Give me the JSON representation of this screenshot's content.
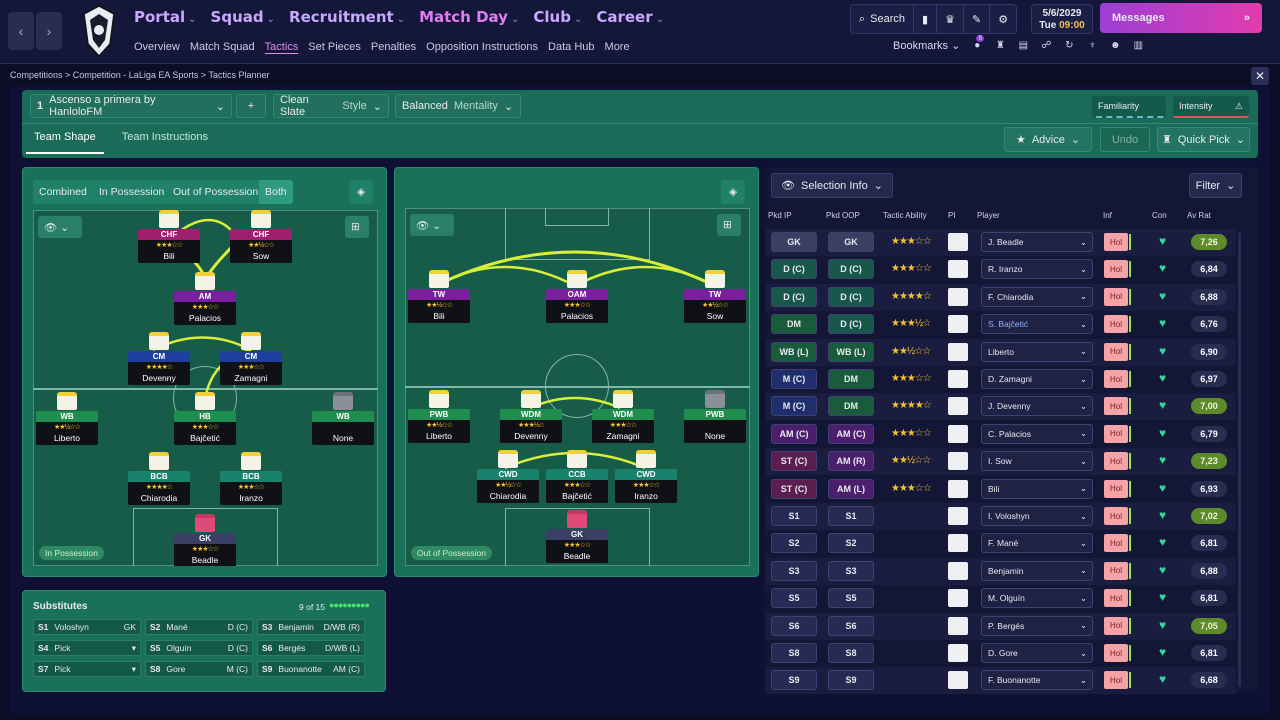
{
  "nav": {
    "main": [
      "Portal",
      "Squad",
      "Recruitment",
      "Match Day",
      "Club",
      "Career"
    ],
    "sub": [
      "Overview",
      "Match Squad",
      "Tactics",
      "Set Pieces",
      "Penalties",
      "Opposition Instructions",
      "Data Hub",
      "More"
    ],
    "search": "Search",
    "date": "5/6/2029",
    "day": "Tue",
    "time": "09:00",
    "messages": "Messages",
    "bookmarks": "Bookmarks",
    "badge": "6"
  },
  "breadcrumb": "Competitions  >  Competition - LaLiga EA Sports  >  Tactics Planner",
  "tactic": {
    "slot": "1",
    "name": "Ascenso a primera by HanloloFM",
    "add": "+",
    "slate": "Clean Slate",
    "slate_mode": "Style",
    "mentality": "Balanced",
    "mentality_mode": "Mentality",
    "familiarity": "Familiarity",
    "intensity": "Intensity",
    "tabs": [
      "Team Shape",
      "Team Instructions"
    ],
    "advice": "Advice",
    "undo": "Undo",
    "quickpick": "Quick Pick"
  },
  "phase": {
    "buttons": [
      "Combined",
      "In Possession",
      "Out of Possession",
      "Both"
    ],
    "in_pos": "In Possession",
    "out_pos": "Out of Possession"
  },
  "colors": {
    "purple": "#7a1f9e",
    "magenta": "#9e1f6e",
    "blue": "#1f3f9e",
    "green": "#1f8d4e",
    "dteal": "#18826d",
    "gk": "#3b3f63"
  },
  "inpos": [
    {
      "role": "CHF",
      "name": "Bili",
      "stars": "★★★☆☆",
      "c": "magenta"
    },
    {
      "role": "CHF",
      "name": "Sow",
      "stars": "★★½☆☆",
      "c": "magenta"
    },
    {
      "role": "AM",
      "name": "Palacios",
      "stars": "★★★☆☆",
      "c": "purple"
    },
    {
      "role": "CM",
      "name": "Devenny",
      "stars": "★★★★☆",
      "c": "blue"
    },
    {
      "role": "CM",
      "name": "Zamagni",
      "stars": "★★★☆☆",
      "c": "blue"
    },
    {
      "role": "WB",
      "name": "Liberto",
      "stars": "★★½☆☆",
      "c": "green"
    },
    {
      "role": "HB",
      "name": "Bajčetić",
      "stars": "★★★☆☆",
      "c": "green"
    },
    {
      "role": "WB",
      "name": "None",
      "stars": "",
      "c": "green"
    },
    {
      "role": "BCB",
      "name": "Chiarodia",
      "stars": "★★★★☆",
      "c": "dteal"
    },
    {
      "role": "BCB",
      "name": "Iranzo",
      "stars": "★★★☆☆",
      "c": "dteal"
    },
    {
      "role": "GK",
      "name": "Beadle",
      "stars": "★★★☆☆",
      "c": "gk"
    }
  ],
  "outpos": [
    {
      "role": "TW",
      "name": "Bili",
      "stars": "★★½☆☆",
      "c": "purple"
    },
    {
      "role": "OAM",
      "name": "Palacios",
      "stars": "★★★☆☆",
      "c": "purple"
    },
    {
      "role": "TW",
      "name": "Sow",
      "stars": "★★½☆☆",
      "c": "purple"
    },
    {
      "role": "PWB",
      "name": "Liberto",
      "stars": "★★½☆☆",
      "c": "green"
    },
    {
      "role": "WDM",
      "name": "Devenny",
      "stars": "★★★½☆",
      "c": "green"
    },
    {
      "role": "WDM",
      "name": "Zamagni",
      "stars": "★★★☆☆",
      "c": "green"
    },
    {
      "role": "PWB",
      "name": "None",
      "stars": "",
      "c": "green"
    },
    {
      "role": "CWD",
      "name": "Chiarodia",
      "stars": "★★½☆☆",
      "c": "dteal"
    },
    {
      "role": "CCB",
      "name": "Bajčetić",
      "stars": "★★★☆☆",
      "c": "dteal"
    },
    {
      "role": "CWD",
      "name": "Iranzo",
      "stars": "★★★☆☆",
      "c": "dteal"
    },
    {
      "role": "GK",
      "name": "Beadle",
      "stars": "★★★☆☆",
      "c": "gk"
    }
  ],
  "subs": {
    "title": "Substitutes",
    "count": "9 of 15",
    "items": [
      [
        "S1",
        "Voloshyn",
        "GK"
      ],
      [
        "S2",
        "Mané",
        "D (C)"
      ],
      [
        "S3",
        "Benjamin",
        "D/WB (R)"
      ],
      [
        "S4",
        "Pick",
        "▾"
      ],
      [
        "S5",
        "Olguín",
        "D (C)"
      ],
      [
        "S6",
        "Bergés",
        "D/WB (L)"
      ],
      [
        "S7",
        "Pick",
        "▾"
      ],
      [
        "S8",
        "Gore",
        "M (C)"
      ],
      [
        "S9",
        "Buonanotte",
        "AM (C)"
      ]
    ]
  },
  "selection": {
    "info": "Selection Info",
    "filter": "Filter",
    "headers": [
      "Pkd IP",
      "Pkd OOP",
      "Tactic Ability",
      "PI",
      "Player",
      "Inf",
      "Con",
      "Av Rat"
    ],
    "rows": [
      [
        "GK",
        "GK",
        "★★★☆☆",
        "J. Beadle",
        "7,26",
        "#5d8a2a",
        "#3b3f63",
        "#3b3f63"
      ],
      [
        "D (C)",
        "D (C)",
        "★★★☆☆",
        "R. Iranzo",
        "6,84",
        "#2a2d52",
        "#18584c",
        "#18584c"
      ],
      [
        "D (C)",
        "D (C)",
        "★★★★☆",
        "F. Chiarodia",
        "6,88",
        "#2a2d52",
        "#18584c",
        "#18584c"
      ],
      [
        "DM",
        "D (C)",
        "★★★½☆",
        "S. Bajčetić",
        "6,76",
        "#2a2d52",
        "#185c3c",
        "#18584c"
      ],
      [
        "WB (L)",
        "WB (L)",
        "★★½☆☆",
        "Liberto",
        "6,90",
        "#2a2d52",
        "#185c3c",
        "#185c3c"
      ],
      [
        "M (C)",
        "DM",
        "★★★☆☆",
        "D. Zamagni",
        "6,97",
        "#2a2d52",
        "#1f2f6e",
        "#185c3c"
      ],
      [
        "M (C)",
        "DM",
        "★★★★☆",
        "J. Devenny",
        "7,00",
        "#5d8a2a",
        "#1f2f6e",
        "#185c3c"
      ],
      [
        "AM (C)",
        "AM (C)",
        "★★★☆☆",
        "C. Palacios",
        "6,79",
        "#2a2d52",
        "#4c1f6e",
        "#4c1f6e"
      ],
      [
        "ST (C)",
        "AM (R)",
        "★★½☆☆",
        "I. Sow",
        "7,23",
        "#5d8a2a",
        "#5a1f50",
        "#4c1f6e"
      ],
      [
        "ST (C)",
        "AM (L)",
        "★★★☆☆",
        "Bili",
        "6,93",
        "#2a2d52",
        "#5a1f50",
        "#4c1f6e"
      ],
      [
        "S1",
        "S1",
        "",
        "I. Voloshyn",
        "7,02",
        "#5d8a2a",
        "#272a52",
        "#272a52"
      ],
      [
        "S2",
        "S2",
        "",
        "F. Mané",
        "6,81",
        "#2a2d52",
        "#272a52",
        "#272a52"
      ],
      [
        "S3",
        "S3",
        "",
        "Benjamin",
        "6,88",
        "#2a2d52",
        "#272a52",
        "#272a52"
      ],
      [
        "S5",
        "S5",
        "",
        "M. Olguín",
        "6,81",
        "#2a2d52",
        "#272a52",
        "#272a52"
      ],
      [
        "S6",
        "S6",
        "",
        "P. Bergés",
        "7,05",
        "#5d8a2a",
        "#272a52",
        "#272a52"
      ],
      [
        "S8",
        "S8",
        "",
        "D. Gore",
        "6,81",
        "#2a2d52",
        "#272a52",
        "#272a52"
      ],
      [
        "S9",
        "S9",
        "",
        "F. Buonanotte",
        "6,68",
        "#2a2d52",
        "#272a52",
        "#272a52"
      ]
    ],
    "inf": "Hol"
  }
}
